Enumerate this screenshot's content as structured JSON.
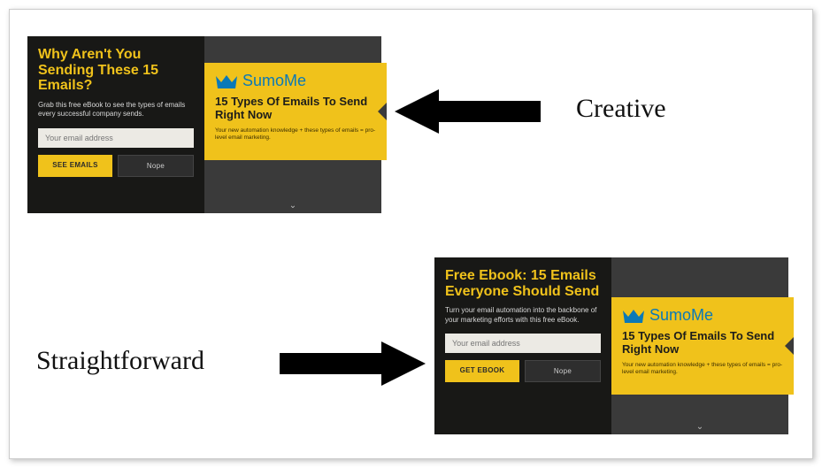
{
  "labels": {
    "creative": "Creative",
    "straightforward": "Straightforward"
  },
  "popup1": {
    "headline": "Why Aren't You Sending These 15 Emails?",
    "sub": "Grab this free eBook to see the types of emails every successful company sends.",
    "placeholder": "Your email address",
    "primary_btn": "SEE EMAILS",
    "secondary_btn": "Nope",
    "logo": "SumoMe",
    "ribbon_title": "15 Types Of Emails To Send Right Now",
    "ribbon_sub": "Your new automation knowledge + these types of emails = pro-level email marketing."
  },
  "popup2": {
    "headline": "Free Ebook: 15 Emails Everyone Should Send",
    "sub": "Turn your email automation into the backbone of your marketing efforts with this free eBook.",
    "placeholder": "Your email address",
    "primary_btn": "GET EBOOK",
    "secondary_btn": "Nope",
    "logo": "SumoMe",
    "ribbon_title": "15 Types Of Emails To Send Right Now",
    "ribbon_sub": "Your new automation knowledge + these types of emails = pro-level email marketing."
  }
}
